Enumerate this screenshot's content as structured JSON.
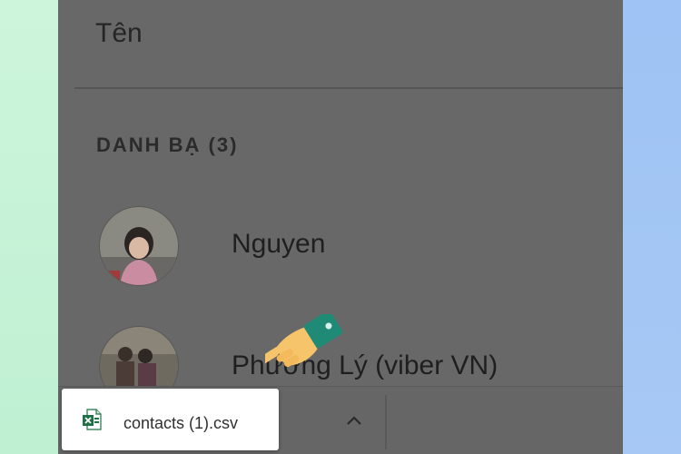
{
  "header": {
    "title": "Tên"
  },
  "contacts_section": {
    "heading": "DANH BẠ (3)",
    "items": [
      {
        "name": "Nguyen",
        "avatar_icon": "child-photo-avatar"
      },
      {
        "name": "Phương Lý (viber VN)",
        "avatar_icon": "group-photo-avatar"
      }
    ]
  },
  "download_bar": {
    "file_name": "contacts (1).csv",
    "file_icon": "excel-file-icon",
    "expand_icon": "chevron-up-icon"
  },
  "colors": {
    "overlay": "#686868",
    "left_edge": "#c7f3d7",
    "right_edge": "#a1c5f4",
    "excel_green": "#1e7145",
    "hand_skin": "#f6c46a",
    "cuff_teal": "#1f8b76"
  }
}
